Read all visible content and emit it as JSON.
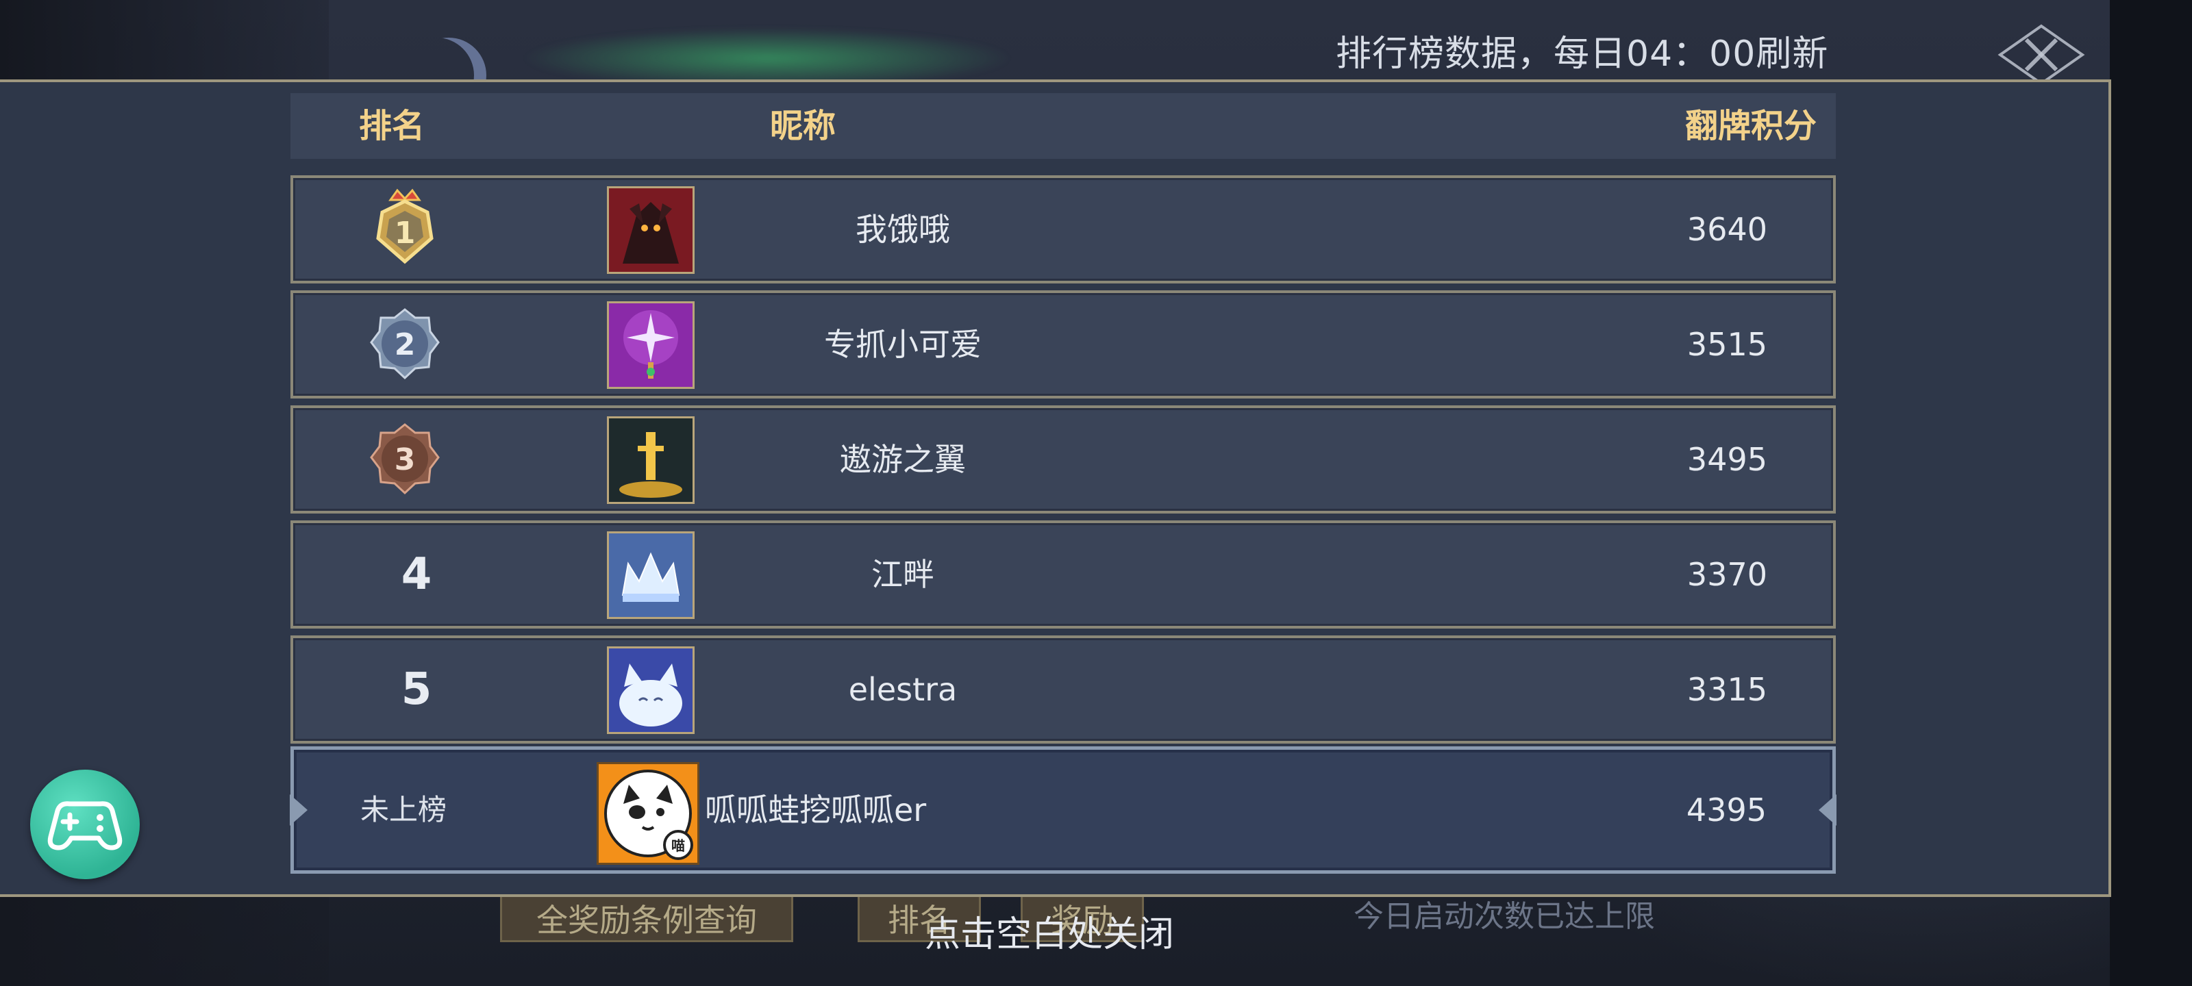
{
  "notice": {
    "refresh": "排行榜数据，每日04：00刷新"
  },
  "header": {
    "rank": "排名",
    "nickname": "昵称",
    "score": "翻牌积分"
  },
  "rows": [
    {
      "rank": "1",
      "nickname": "我饿哦",
      "score": "3640",
      "badge": "gold-crown-badge"
    },
    {
      "rank": "2",
      "nickname": "专抓小可爱",
      "score": "3515",
      "badge": "silver-badge"
    },
    {
      "rank": "3",
      "nickname": "遨游之翼",
      "score": "3495",
      "badge": "bronze-badge"
    },
    {
      "rank": "4",
      "nickname": "江畔",
      "score": "3370"
    },
    {
      "rank": "5",
      "nickname": "elestra",
      "score": "3315"
    }
  ],
  "self": {
    "rank": "未上榜",
    "nickname": "呱呱蛙挖呱呱er",
    "score": "4395"
  },
  "bottom": {
    "query": "全奖励条例查询",
    "rank_tab": "排名",
    "reward_tab": "奖励",
    "limit": "今日启动次数已达上限",
    "tap_close": "点击空白处关闭"
  },
  "colors": {
    "panel": "#2e3749",
    "row": "#3a4458",
    "header_text": "#f3d28a",
    "accent_green": "#2fb495"
  }
}
